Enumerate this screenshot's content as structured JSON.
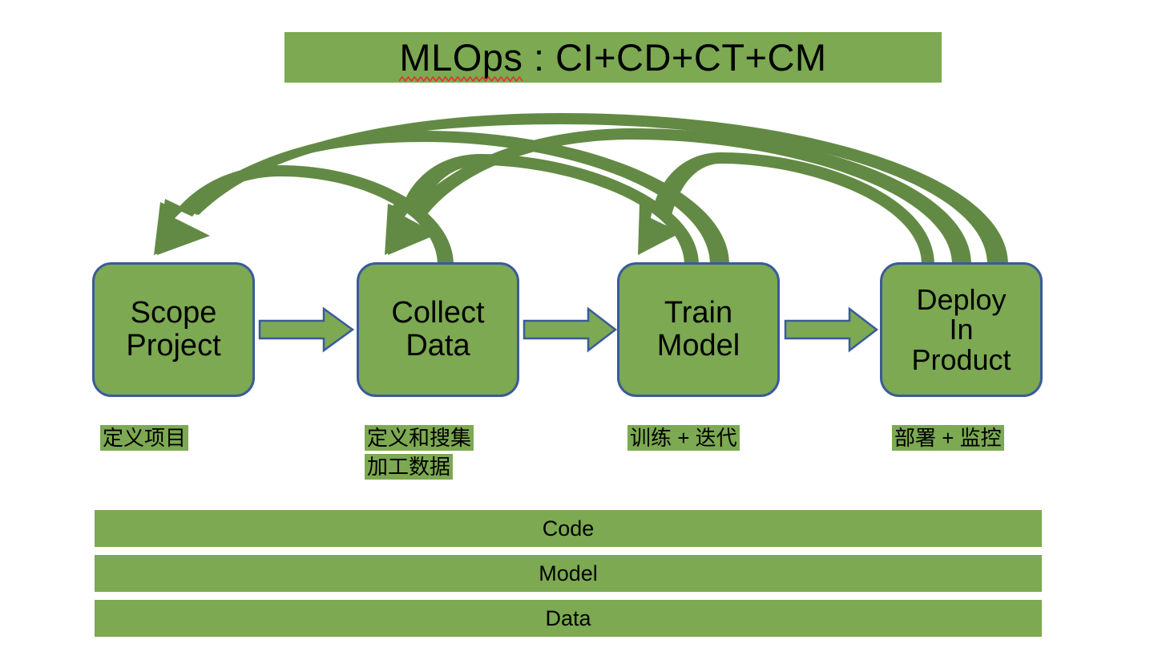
{
  "title": {
    "spelled_word": "MLOps",
    "rest": " : CI+CD+CT+CM",
    "full": "MLOps : CI+CD+CT+CM",
    "has_spellcheck_underline": true,
    "underline_color": "#E03131",
    "band_color": "#7CA951"
  },
  "colors": {
    "box_fill": "#7CA951",
    "box_border": "#3B5A9B",
    "highlight": "#7CA951",
    "feedback_arrow": "#628A44",
    "straight_arrow_fill": "#7CA951",
    "straight_arrow_stroke": "#3B5A9B",
    "background": "#FFFFFF",
    "text": "#000000"
  },
  "stages": [
    {
      "id": "scope-project",
      "label": "Scope\nProject",
      "caption_lines": [
        "定义项目"
      ]
    },
    {
      "id": "collect-data",
      "label": "Collect\nData",
      "caption_lines": [
        "定义和搜集",
        "加工数据"
      ]
    },
    {
      "id": "train-model",
      "label": "Train\nModel",
      "caption_lines": [
        "训练 + 迭代"
      ]
    },
    {
      "id": "deploy-in-product",
      "label": "Deploy\nIn\nProduct",
      "caption_lines": [
        "部署 + 监控"
      ]
    }
  ],
  "flow_arrows": [
    {
      "from": "scope-project",
      "to": "collect-data"
    },
    {
      "from": "collect-data",
      "to": "train-model"
    },
    {
      "from": "train-model",
      "to": "deploy-in-product"
    }
  ],
  "feedback_arrows": [
    {
      "from": "collect-data",
      "to": "scope-project"
    },
    {
      "from": "train-model",
      "to": "scope-project"
    },
    {
      "from": "deploy-in-product",
      "to": "scope-project"
    },
    {
      "from": "train-model",
      "to": "collect-data"
    },
    {
      "from": "deploy-in-product",
      "to": "collect-data"
    },
    {
      "from": "deploy-in-product",
      "to": "train-model"
    }
  ],
  "foundation_bars": [
    {
      "id": "code-bar",
      "label": "Code"
    },
    {
      "id": "model-bar",
      "label": "Model"
    },
    {
      "id": "data-bar",
      "label": "Data"
    }
  ]
}
